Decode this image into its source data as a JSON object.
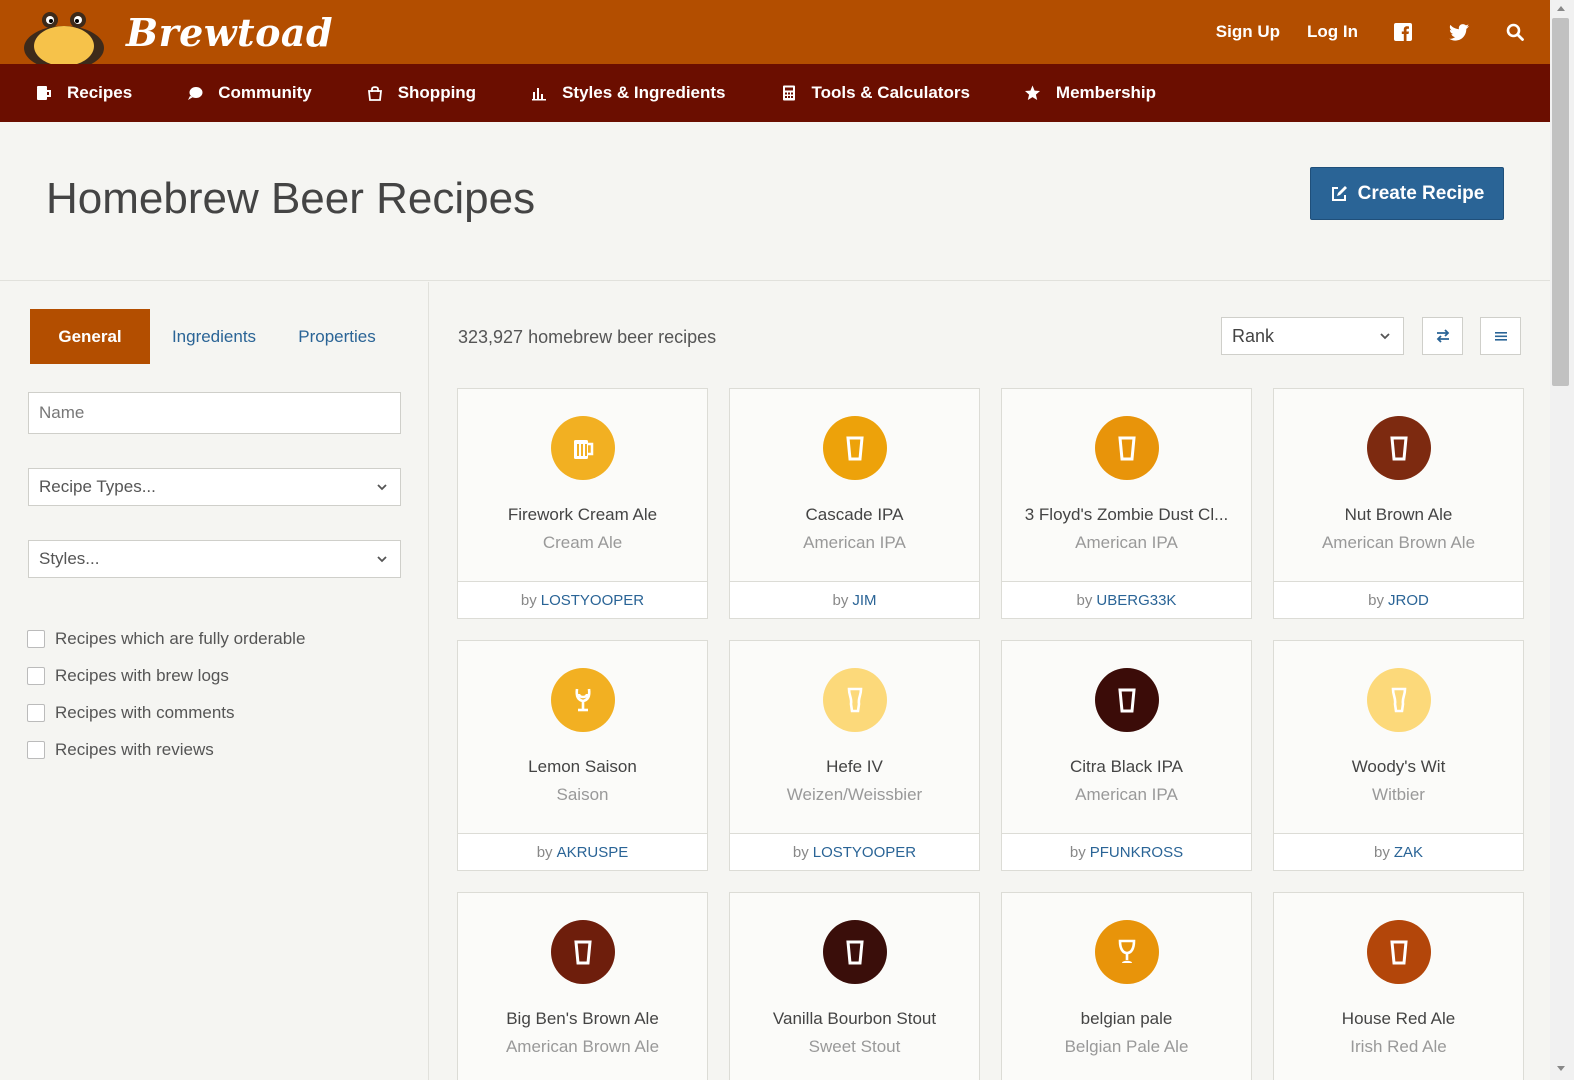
{
  "brand": {
    "name": "Brewtoad"
  },
  "top": {
    "sign_up": "Sign Up",
    "log_in": "Log In",
    "icons": [
      "facebook-icon",
      "twitter-icon",
      "search-icon"
    ]
  },
  "nav": [
    {
      "label": "Recipes",
      "icon": "beer-mug-icon"
    },
    {
      "label": "Community",
      "icon": "chat-bubble-icon"
    },
    {
      "label": "Shopping",
      "icon": "shopping-bag-icon"
    },
    {
      "label": "Styles & Ingredients",
      "icon": "bar-chart-icon"
    },
    {
      "label": "Tools & Calculators",
      "icon": "calculator-icon"
    },
    {
      "label": "Membership",
      "icon": "star-icon"
    }
  ],
  "header": {
    "title": "Homebrew Beer Recipes",
    "create_button": "Create Recipe"
  },
  "sidebar": {
    "tabs": [
      "General",
      "Ingredients",
      "Properties"
    ],
    "name_placeholder": "Name",
    "recipe_types": "Recipe Types...",
    "styles": "Styles...",
    "checkboxes": [
      "Recipes which are fully orderable",
      "Recipes with brew logs",
      "Recipes with comments",
      "Recipes with reviews"
    ]
  },
  "main": {
    "count_text": "323,927 homebrew beer recipes",
    "sort_value": "Rank",
    "by_prefix": "by",
    "colors": {
      "accent": "#b34e00",
      "nav": "#6b0e00",
      "button": "#2a6496"
    },
    "recipes": [
      {
        "name": "Firework Cream Ale",
        "style": "Cream Ale",
        "author": "LOSTYOOPER",
        "color": "#f2b022",
        "glass": "mug"
      },
      {
        "name": "Cascade IPA",
        "style": "American IPA",
        "author": "JIM",
        "color": "#eda20a",
        "glass": "pint"
      },
      {
        "name": "3 Floyd's Zombie Dust Cl...",
        "style": "American IPA",
        "author": "UBERG33K",
        "color": "#e8940a",
        "glass": "pint"
      },
      {
        "name": "Nut Brown Ale",
        "style": "American Brown Ale",
        "author": "JROD",
        "color": "#7d2a10",
        "glass": "pint"
      },
      {
        "name": "Lemon Saison",
        "style": "Saison",
        "author": "AKRUSPE",
        "color": "#f2b022",
        "glass": "tulip"
      },
      {
        "name": "Hefe IV",
        "style": "Weizen/Weissbier",
        "author": "LOSTYOOPER",
        "color": "#fcd97a",
        "glass": "weizen"
      },
      {
        "name": "Citra Black IPA",
        "style": "American IPA",
        "author": "PFUNKROSS",
        "color": "#3b0c08",
        "glass": "pint"
      },
      {
        "name": "Woody's Wit",
        "style": "Witbier",
        "author": "ZAK",
        "color": "#fcd97a",
        "glass": "weizen"
      },
      {
        "name": "Big Ben's Brown Ale",
        "style": "American Brown Ale",
        "author": "",
        "color": "#6e1e0c",
        "glass": "pint"
      },
      {
        "name": "Vanilla Bourbon Stout",
        "style": "Sweet Stout",
        "author": "",
        "color": "#3a0e0a",
        "glass": "pint"
      },
      {
        "name": "belgian pale",
        "style": "Belgian Pale Ale",
        "author": "",
        "color": "#e8940a",
        "glass": "goblet"
      },
      {
        "name": "House Red Ale",
        "style": "Irish Red Ale",
        "author": "",
        "color": "#b3460a",
        "glass": "pint"
      }
    ]
  }
}
